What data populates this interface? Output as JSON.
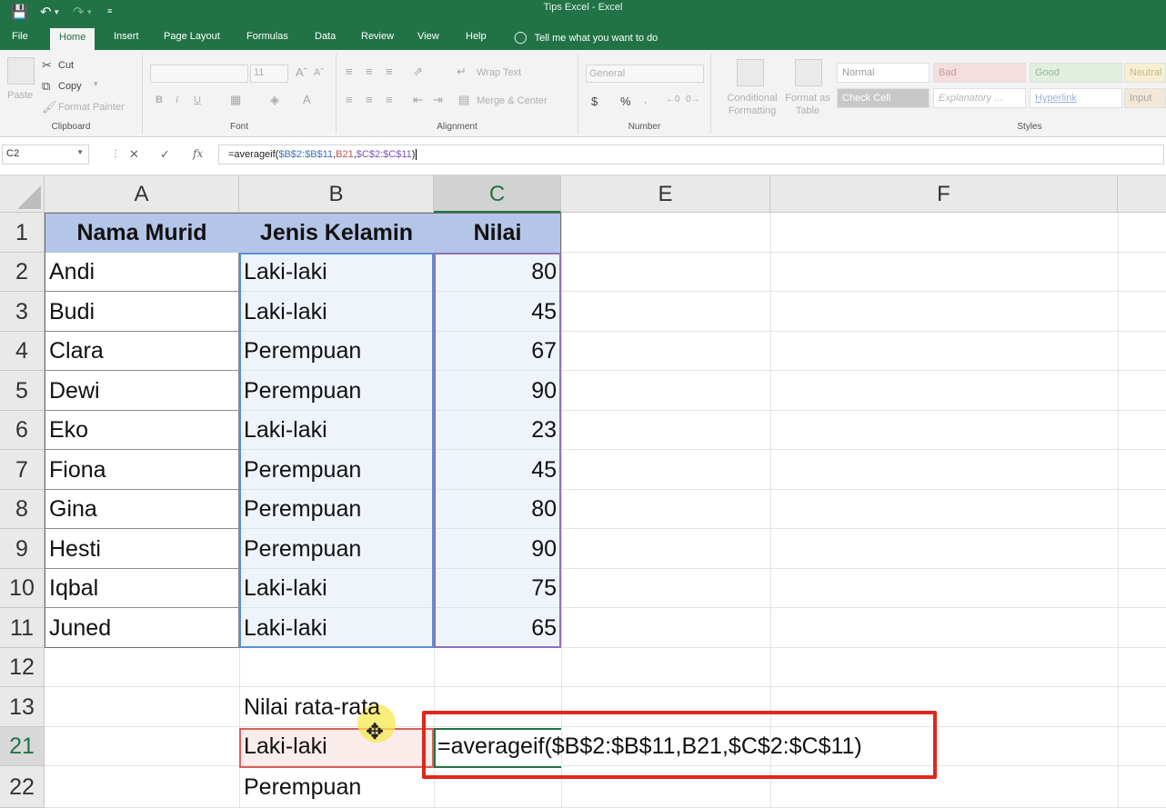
{
  "window": {
    "title": "Tips Excel  -  Excel"
  },
  "quick_access": {
    "save_icon": "save-icon",
    "undo_icon": "undo-icon",
    "redo_icon": "redo-icon",
    "customize_icon": "customize-icon"
  },
  "tabs": [
    "File",
    "Home",
    "Insert",
    "Page Layout",
    "Formulas",
    "Data",
    "Review",
    "View",
    "Help"
  ],
  "active_tab": "Home",
  "tell_me": "Tell me what you want to do",
  "ribbon": {
    "clipboard": {
      "label": "Clipboard",
      "paste": "Paste",
      "cut": "Cut",
      "copy": "Copy",
      "format_painter": "Format Painter"
    },
    "font": {
      "label": "Font",
      "size": "11",
      "bold": "B",
      "italic": "I",
      "underline": "U"
    },
    "alignment": {
      "label": "Alignment",
      "wrap_text": "Wrap Text",
      "merge_center": "Merge & Center"
    },
    "number": {
      "label": "Number",
      "format": "General",
      "currency": "$",
      "percent": "%"
    },
    "styles": {
      "label": "Styles",
      "conditional_formatting": "Conditional Formatting",
      "format_as_table": "Format as Table",
      "cells": [
        {
          "name": "Normal",
          "bg": "#ffffff",
          "fg": "#9a9a9a"
        },
        {
          "name": "Bad",
          "bg": "#f4dede",
          "fg": "#c59a9a"
        },
        {
          "name": "Good",
          "bg": "#e1efe1",
          "fg": "#98b798"
        },
        {
          "name": "Neutral",
          "bg": "#f6efd2",
          "fg": "#c7b784"
        },
        {
          "name": "Check Cell",
          "bg": "#c8c8c8",
          "fg": "#ffffff"
        },
        {
          "name": "Explanatory ...",
          "bg": "#ffffff",
          "fg": "#b5b5b5"
        },
        {
          "name": "Hyperlink",
          "bg": "#ffffff",
          "fg": "#9fb2d6"
        },
        {
          "name": "Input",
          "bg": "#f2e7d8",
          "fg": "#a8a8a8"
        }
      ]
    }
  },
  "formula_bar": {
    "name_box": "C2",
    "cancel_icon": "cancel-icon",
    "enter_icon": "check-icon",
    "fx_icon": "fx-icon",
    "prefix": "=averageif(",
    "ref1": "$B$2:$B$11",
    "sep1": ",",
    "ref2": "B21",
    "sep2": ",",
    "ref3": "$C$2:$C$11",
    "suffix": ")"
  },
  "columns": [
    "A",
    "B",
    "C",
    "E",
    "F"
  ],
  "selected_column": "C",
  "rows": [
    "1",
    "2",
    "3",
    "4",
    "5",
    "6",
    "7",
    "8",
    "9",
    "10",
    "11",
    "12",
    "13",
    "21",
    "22"
  ],
  "selected_row": "21",
  "table": {
    "headers": [
      "Nama Murid",
      "Jenis Kelamin",
      "Nilai"
    ],
    "rows": [
      [
        "Andi",
        "Laki-laki",
        "80"
      ],
      [
        "Budi",
        "Laki-laki",
        "45"
      ],
      [
        "Clara",
        "Perempuan",
        "67"
      ],
      [
        "Dewi",
        "Perempuan",
        "90"
      ],
      [
        "Eko",
        "Laki-laki",
        "23"
      ],
      [
        "Fiona",
        "Perempuan",
        "45"
      ],
      [
        "Gina",
        "Perempuan",
        "80"
      ],
      [
        "Hesti",
        "Perempuan",
        "90"
      ],
      [
        "Iqbal",
        "Laki-laki",
        "75"
      ],
      [
        "Juned",
        "Laki-laki",
        "65"
      ]
    ]
  },
  "summary": {
    "label": "Nilai rata-rata",
    "row21_label": "Laki-laki",
    "row21_formula": "=averageif($B$2:$B$11,B21,$C$2:$C$11)",
    "row22_label": "Perempuan"
  },
  "colors": {
    "excel_green": "#217346",
    "header_fill": "#b4c6e7",
    "callout_red": "#e0261b",
    "ref_blue": "#3a72c2",
    "ref_red": "#c0504d",
    "ref_purple": "#7a55b0"
  }
}
